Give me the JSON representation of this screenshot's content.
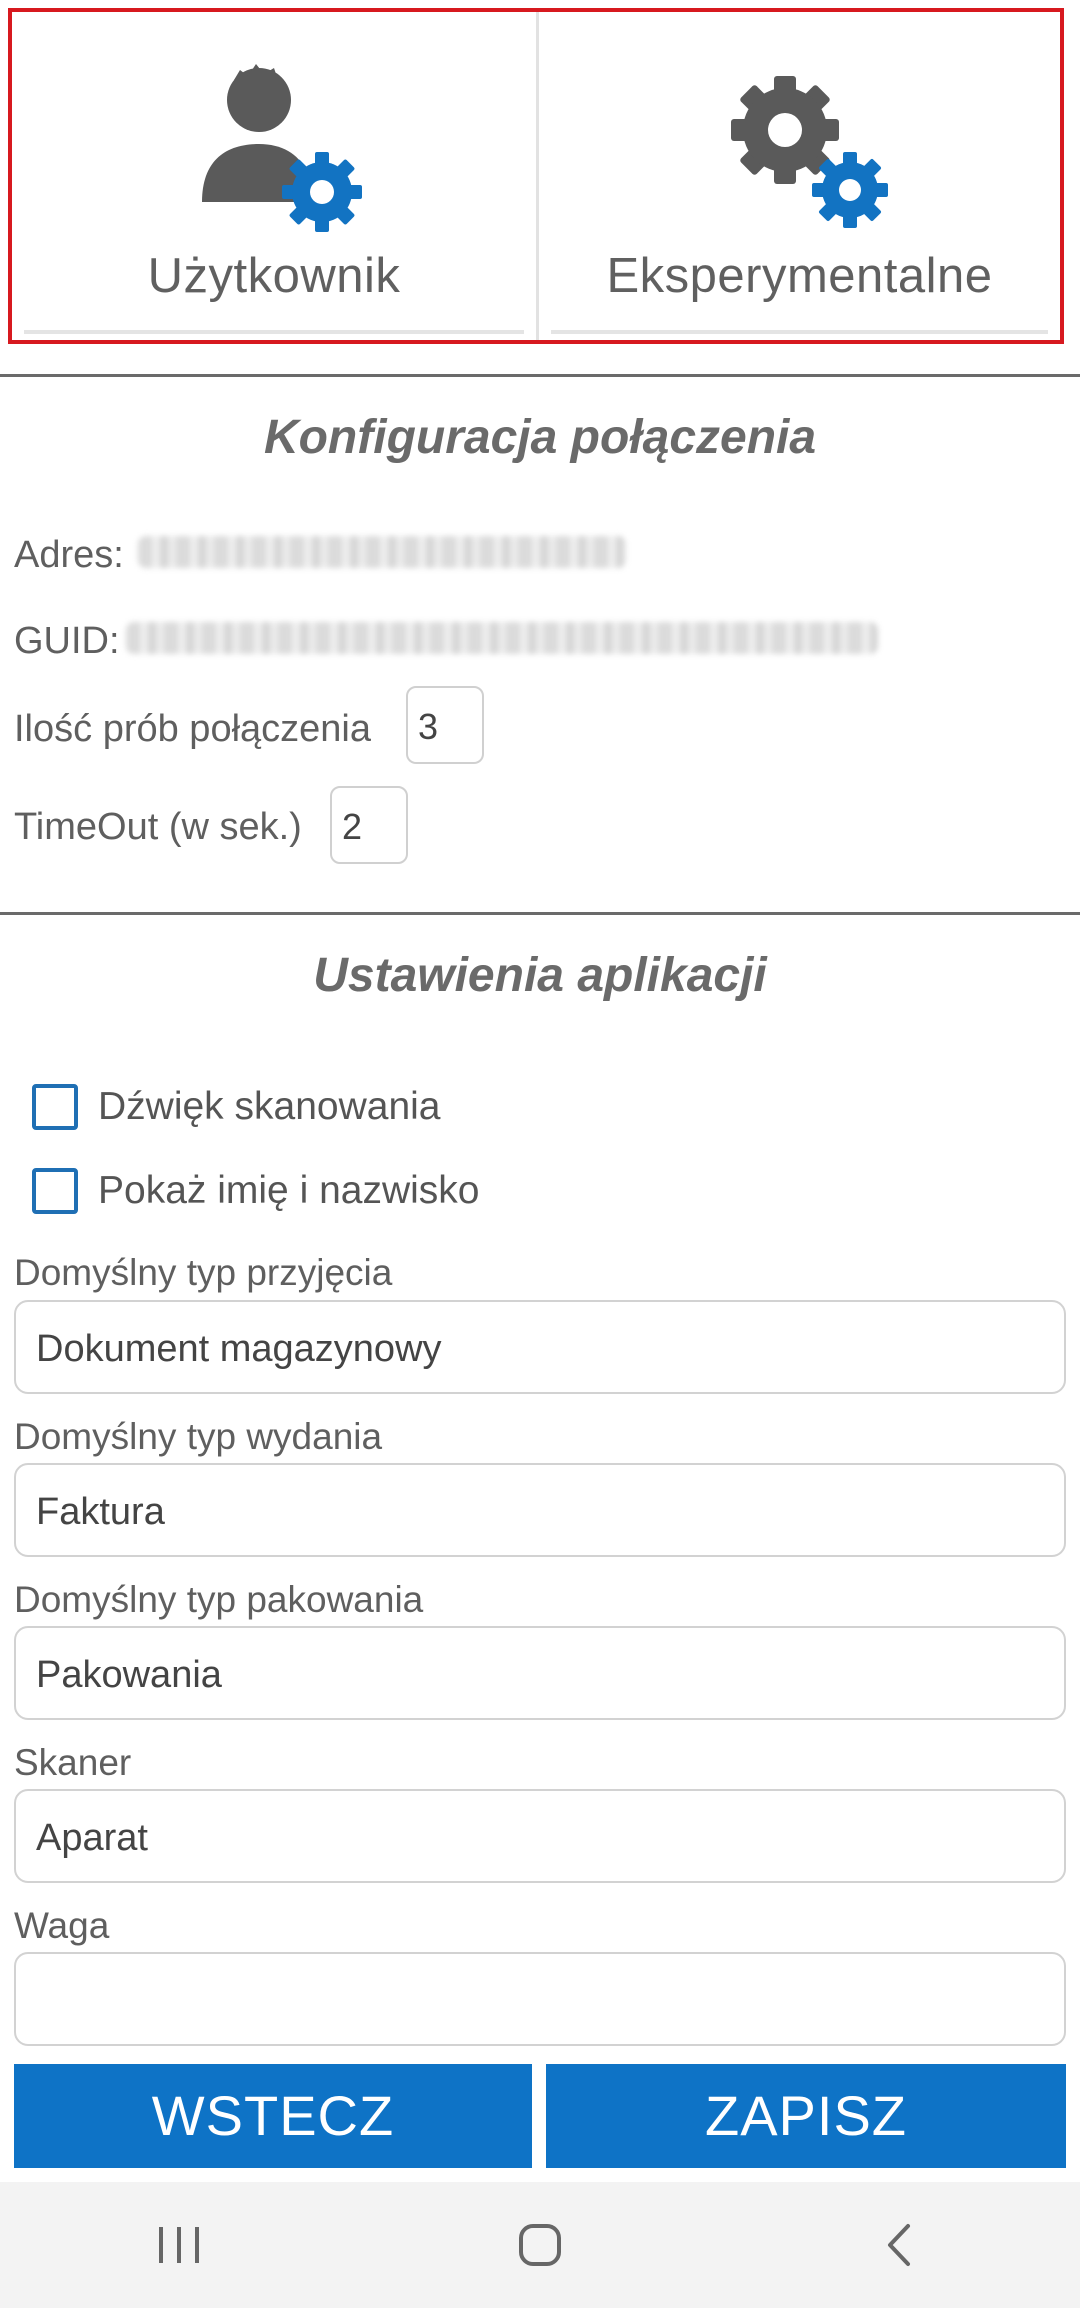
{
  "tiles": {
    "user": {
      "label": "Użytkownik",
      "icon": "user-settings-icon"
    },
    "experimental": {
      "label": "Eksperymentalne",
      "icon": "gears-icon"
    }
  },
  "connection": {
    "title": "Konfiguracja połączenia",
    "address_label": "Adres:",
    "guid_label": "GUID:",
    "retries_label": "Ilość prób połączenia",
    "retries_value": "3",
    "timeout_label": "TimeOut (w sek.)",
    "timeout_value": "2"
  },
  "app_settings": {
    "title": "Ustawienia aplikacji",
    "checkboxes": [
      {
        "label": "Dźwięk skanowania",
        "checked": false
      },
      {
        "label": "Pokaż imię i nazwisko",
        "checked": false
      }
    ],
    "fields": [
      {
        "label": "Domyślny typ przyjęcia",
        "value": "Dokument magazynowy"
      },
      {
        "label": "Domyślny typ wydania",
        "value": "Faktura"
      },
      {
        "label": "Domyślny typ pakowania",
        "value": "Pakowania"
      },
      {
        "label": "Skaner",
        "value": "Aparat"
      },
      {
        "label": "Waga",
        "value": ""
      }
    ]
  },
  "buttons": {
    "back": "WSTECZ",
    "save": "ZAPISZ"
  },
  "colors": {
    "accent": "#0e73c6",
    "icon_gray": "#5a5a5a",
    "highlight": "#d7191f"
  }
}
